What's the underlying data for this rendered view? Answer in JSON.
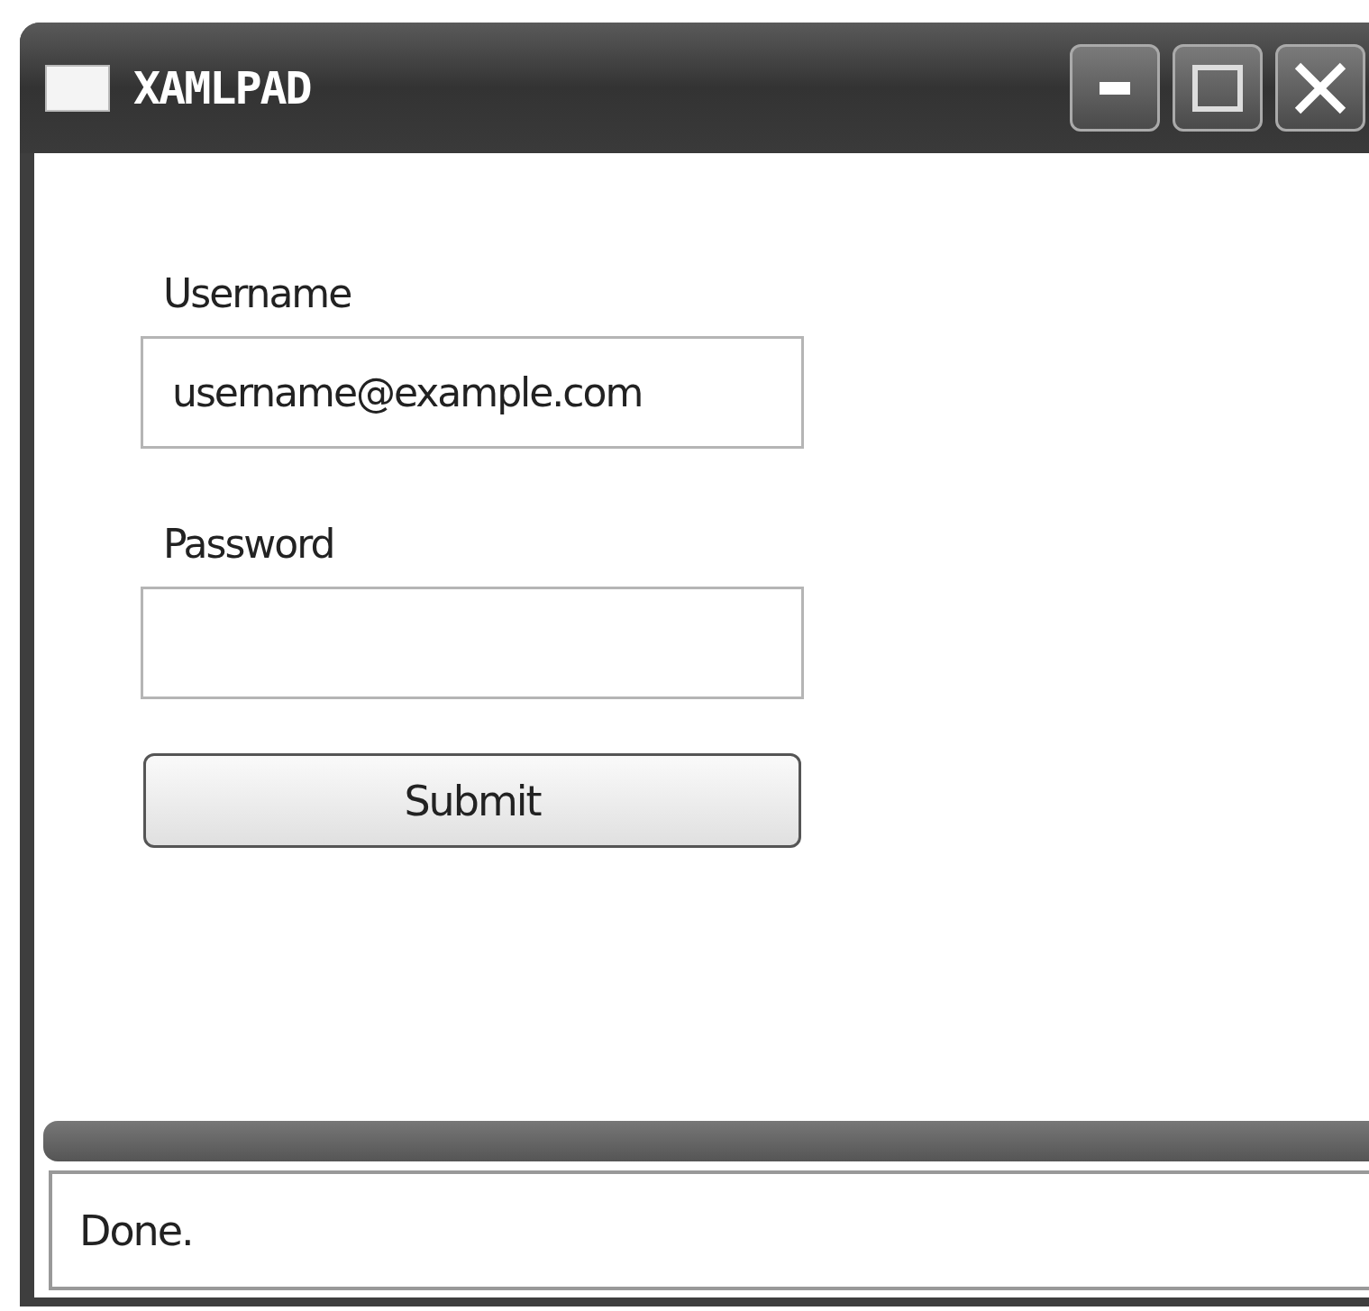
{
  "window": {
    "title": "XAMLPAD"
  },
  "fields": [
    {
      "label": "Username",
      "value": "username@example.com"
    },
    {
      "label": "Password"
    }
  ],
  "submit_button": {
    "label": "Submit"
  },
  "status_bar": {
    "text": "Done."
  }
}
